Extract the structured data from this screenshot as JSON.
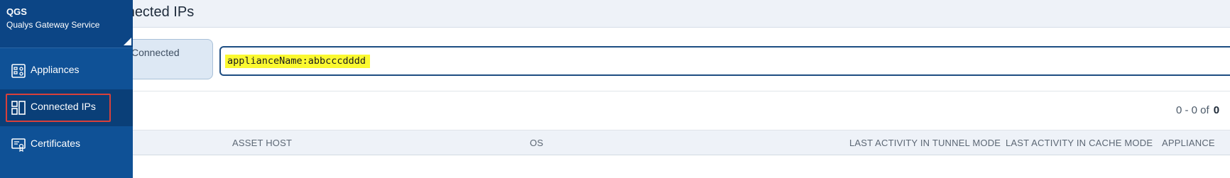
{
  "header": {
    "title": "Connected IPs"
  },
  "brand": {
    "name": "QGS",
    "subtitle": "Qualys Gateway Service"
  },
  "sidebar": {
    "items": [
      {
        "label": "Appliances",
        "icon": "appliances-icon"
      },
      {
        "label": "Connected IPs",
        "icon": "connected-ips-icon",
        "active": true
      },
      {
        "label": "Certificates",
        "icon": "certificates-icon"
      }
    ]
  },
  "filter_card": {
    "label": "Connected"
  },
  "search": {
    "query": "applianceName:abbcccdddd"
  },
  "pagination": {
    "range": "0 - 0 of",
    "total": "0"
  },
  "table": {
    "columns": [
      "ASSET HOST",
      "OS",
      "LAST ACTIVITY IN TUNNEL MODE",
      "LAST ACTIVITY IN CACHE MODE",
      "APPLIANCE"
    ]
  },
  "colors": {
    "sidebar": "#0f5196",
    "highlight": "#fbf930",
    "active_outline": "#d9403a"
  }
}
